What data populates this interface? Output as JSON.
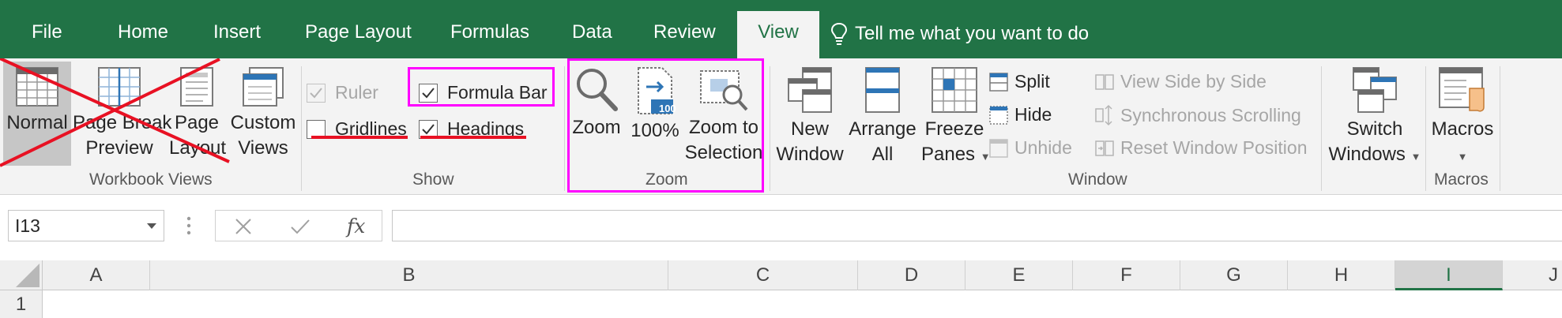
{
  "tabs": [
    {
      "label": "File",
      "active": false
    },
    {
      "label": "Home",
      "active": false
    },
    {
      "label": "Insert",
      "active": false
    },
    {
      "label": "Page Layout",
      "active": false
    },
    {
      "label": "Formulas",
      "active": false
    },
    {
      "label": "Data",
      "active": false
    },
    {
      "label": "Review",
      "active": false
    },
    {
      "label": "View",
      "active": true
    }
  ],
  "tell_me": {
    "label": "Tell me what you want to do",
    "icon": "lightbulb-icon"
  },
  "ribbon": {
    "workbook_views": {
      "group_label": "Workbook Views",
      "normal": {
        "label": "Normal",
        "selected": true,
        "crossed_out": true
      },
      "page_break": {
        "line1": "Page Break",
        "line2": "Preview",
        "crossed_out": true
      },
      "page_layout": {
        "line1": "Page",
        "line2": "Layout",
        "crossed_out": true
      },
      "custom_views": {
        "line1": "Custom",
        "line2": "Views"
      }
    },
    "show": {
      "group_label": "Show",
      "ruler": {
        "label": "Ruler",
        "checked": true,
        "enabled": false
      },
      "formula_bar": {
        "label": "Formula Bar",
        "checked": true,
        "highlighted": true
      },
      "gridlines": {
        "label": "Gridlines",
        "checked": false,
        "crossed_out": true
      },
      "headings": {
        "label": "Headings",
        "checked": true,
        "crossed_out": true
      }
    },
    "zoom": {
      "group_label": "Zoom",
      "zoom": {
        "label": "Zoom"
      },
      "hundred": {
        "label": "100%",
        "badge": "100"
      },
      "zoom_to_selection": {
        "line1": "Zoom to",
        "line2": "Selection"
      }
    },
    "window": {
      "group_label": "Window",
      "new_window": {
        "line1": "New",
        "line2": "Window"
      },
      "arrange_all": {
        "line1": "Arrange",
        "line2": "All"
      },
      "freeze_panes": {
        "line1": "Freeze",
        "line2": "Panes"
      },
      "split": {
        "label": "Split"
      },
      "hide": {
        "label": "Hide"
      },
      "unhide": {
        "label": "Unhide"
      },
      "side_by_side": {
        "label": "View Side by Side"
      },
      "sync_scroll": {
        "label": "Synchronous Scrolling"
      },
      "reset_position": {
        "label": "Reset Window Position"
      },
      "switch_windows": {
        "line1": "Switch",
        "line2": "Windows"
      }
    },
    "macros": {
      "group_label": "Macros",
      "macros": {
        "label": "Macros"
      }
    }
  },
  "formula_bar": {
    "name_box": "I13",
    "cancel_icon": "close-icon",
    "enter_icon": "check-icon",
    "function_label": "fx",
    "content": ""
  },
  "sheet": {
    "columns": [
      {
        "label": "A",
        "selected": false
      },
      {
        "label": "B",
        "selected": false
      },
      {
        "label": "C",
        "selected": false
      },
      {
        "label": "D",
        "selected": false
      },
      {
        "label": "E",
        "selected": false
      },
      {
        "label": "F",
        "selected": false
      },
      {
        "label": "G",
        "selected": false
      },
      {
        "label": "H",
        "selected": false
      },
      {
        "label": "I",
        "selected": true
      },
      {
        "label": "J",
        "selected": false
      }
    ],
    "rows": [
      "1"
    ]
  },
  "colors": {
    "excel_green": "#217346",
    "annotation_magenta": "#ff00ff",
    "annotation_red": "#e81123"
  }
}
